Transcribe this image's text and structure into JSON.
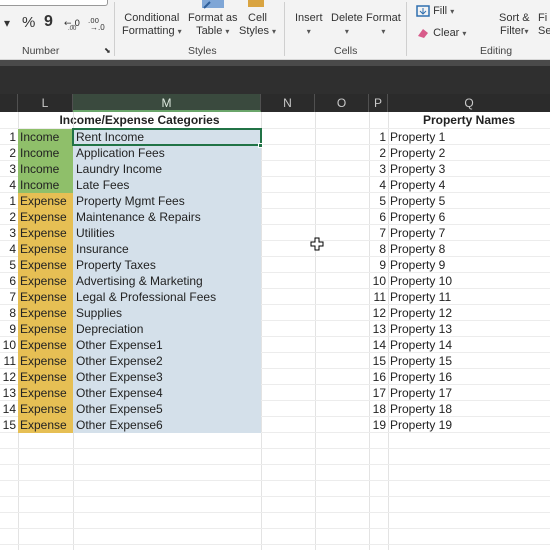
{
  "ribbon": {
    "number_group": {
      "label": "Number",
      "percent_symbol": "%",
      "comma_symbol": "9"
    },
    "styles_group": {
      "label": "Styles",
      "conditional_formatting": [
        "Conditional",
        "Formatting"
      ],
      "format_as_table": [
        "Format as",
        "Table"
      ],
      "cell_styles": [
        "Cell",
        "Styles"
      ]
    },
    "cells_group": {
      "label": "Cells",
      "insert": "Insert",
      "delete": "Delete",
      "format": "Format"
    },
    "editing_group": {
      "label": "Editing",
      "fill": "Fill",
      "clear": "Clear",
      "sort_filter": [
        "Sort &",
        "Filter"
      ],
      "find_select": [
        "Fi",
        "Se"
      ]
    }
  },
  "columns": [
    "L",
    "M",
    "N",
    "O",
    "P",
    "Q"
  ],
  "sheet": {
    "categories_header": "Income/Expense Categories",
    "properties_header": "Property Names",
    "categories": [
      {
        "num": "1",
        "type": "Income",
        "name": "Rent Income"
      },
      {
        "num": "2",
        "type": "Income",
        "name": "Application Fees"
      },
      {
        "num": "3",
        "type": "Income",
        "name": "Laundry Income"
      },
      {
        "num": "4",
        "type": "Income",
        "name": "Late Fees"
      },
      {
        "num": "1",
        "type": "Expense",
        "name": "Property Mgmt Fees"
      },
      {
        "num": "2",
        "type": "Expense",
        "name": "Maintenance & Repairs"
      },
      {
        "num": "3",
        "type": "Expense",
        "name": "Utilities"
      },
      {
        "num": "4",
        "type": "Expense",
        "name": "Insurance"
      },
      {
        "num": "5",
        "type": "Expense",
        "name": "Property Taxes"
      },
      {
        "num": "6",
        "type": "Expense",
        "name": "Advertising & Marketing"
      },
      {
        "num": "7",
        "type": "Expense",
        "name": "Legal & Professional Fees"
      },
      {
        "num": "8",
        "type": "Expense",
        "name": "Supplies"
      },
      {
        "num": "9",
        "type": "Expense",
        "name": "Depreciation"
      },
      {
        "num": "10",
        "type": "Expense",
        "name": "Other Expense1"
      },
      {
        "num": "11",
        "type": "Expense",
        "name": "Other Expense2"
      },
      {
        "num": "12",
        "type": "Expense",
        "name": "Other Expense3"
      },
      {
        "num": "13",
        "type": "Expense",
        "name": "Other Expense4"
      },
      {
        "num": "14",
        "type": "Expense",
        "name": "Other Expense5"
      },
      {
        "num": "15",
        "type": "Expense",
        "name": "Other Expense6"
      }
    ],
    "properties": [
      {
        "num": "1",
        "name": "Property 1"
      },
      {
        "num": "2",
        "name": "Property 2"
      },
      {
        "num": "3",
        "name": "Property 3"
      },
      {
        "num": "4",
        "name": "Property 4"
      },
      {
        "num": "5",
        "name": "Property 5"
      },
      {
        "num": "6",
        "name": "Property 6"
      },
      {
        "num": "7",
        "name": "Property 7"
      },
      {
        "num": "8",
        "name": "Property 8"
      },
      {
        "num": "9",
        "name": "Property 9"
      },
      {
        "num": "10",
        "name": "Property 10"
      },
      {
        "num": "11",
        "name": "Property 11"
      },
      {
        "num": "12",
        "name": "Property 12"
      },
      {
        "num": "13",
        "name": "Property 13"
      },
      {
        "num": "14",
        "name": "Property 14"
      },
      {
        "num": "15",
        "name": "Property 15"
      },
      {
        "num": "16",
        "name": "Property 16"
      },
      {
        "num": "17",
        "name": "Property 17"
      },
      {
        "num": "18",
        "name": "Property 18"
      },
      {
        "num": "19",
        "name": "Property 19"
      }
    ]
  },
  "colors": {
    "income_fill": "#8fbf6a",
    "expense_fill": "#e6bf54",
    "category_fill": "#d4e0ea",
    "selection_border": "#217346"
  }
}
